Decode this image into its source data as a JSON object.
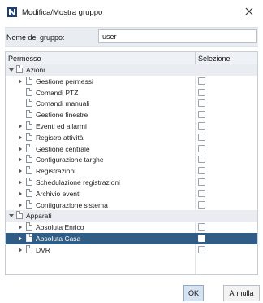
{
  "window": {
    "title": "Modifica/Mostra gruppo"
  },
  "name_field": {
    "label": "Nome del gruppo:",
    "value": "user"
  },
  "table": {
    "headers": {
      "permission": "Permesso",
      "selection": "Selezione"
    },
    "rows": [
      {
        "label": "Azioni",
        "level": 0,
        "expander": "down",
        "group": true,
        "checkbox": false,
        "selected": false
      },
      {
        "label": "Gestione permessi",
        "level": 1,
        "expander": "right",
        "group": false,
        "checkbox": true,
        "selected": false
      },
      {
        "label": "Comandi PTZ",
        "level": 1,
        "expander": "none",
        "group": false,
        "checkbox": true,
        "selected": false
      },
      {
        "label": "Comandi manuali",
        "level": 1,
        "expander": "none",
        "group": false,
        "checkbox": true,
        "selected": false
      },
      {
        "label": "Gestione finestre",
        "level": 1,
        "expander": "none",
        "group": false,
        "checkbox": true,
        "selected": false
      },
      {
        "label": "Eventi ed allarmi",
        "level": 1,
        "expander": "right",
        "group": false,
        "checkbox": true,
        "selected": false
      },
      {
        "label": "Registro attività",
        "level": 1,
        "expander": "right",
        "group": false,
        "checkbox": true,
        "selected": false
      },
      {
        "label": "Gestione centrale",
        "level": 1,
        "expander": "right",
        "group": false,
        "checkbox": true,
        "selected": false
      },
      {
        "label": "Configurazione targhe",
        "level": 1,
        "expander": "right",
        "group": false,
        "checkbox": true,
        "selected": false
      },
      {
        "label": "Registrazioni",
        "level": 1,
        "expander": "right",
        "group": false,
        "checkbox": true,
        "selected": false
      },
      {
        "label": "Schedulazione registrazioni",
        "level": 1,
        "expander": "right",
        "group": false,
        "checkbox": true,
        "selected": false
      },
      {
        "label": "Archivio eventi",
        "level": 1,
        "expander": "right",
        "group": false,
        "checkbox": true,
        "selected": false
      },
      {
        "label": "Configurazione sistema",
        "level": 1,
        "expander": "right",
        "group": false,
        "checkbox": true,
        "selected": false
      },
      {
        "label": "Apparati",
        "level": 0,
        "expander": "down",
        "group": true,
        "checkbox": false,
        "selected": false
      },
      {
        "label": "Absoluta Enrico",
        "level": 1,
        "expander": "right",
        "group": false,
        "checkbox": true,
        "selected": false
      },
      {
        "label": "Absoluta Casa",
        "level": 1,
        "expander": "right",
        "group": false,
        "checkbox": true,
        "selected": true
      },
      {
        "label": "DVR",
        "level": 1,
        "expander": "right",
        "group": false,
        "checkbox": true,
        "selected": false
      }
    ]
  },
  "buttons": {
    "ok": "OK",
    "cancel": "Annulla"
  },
  "colors": {
    "selection": "#2f5d86",
    "group_row": "#e9edf2",
    "accent": "#1b4f8a"
  }
}
